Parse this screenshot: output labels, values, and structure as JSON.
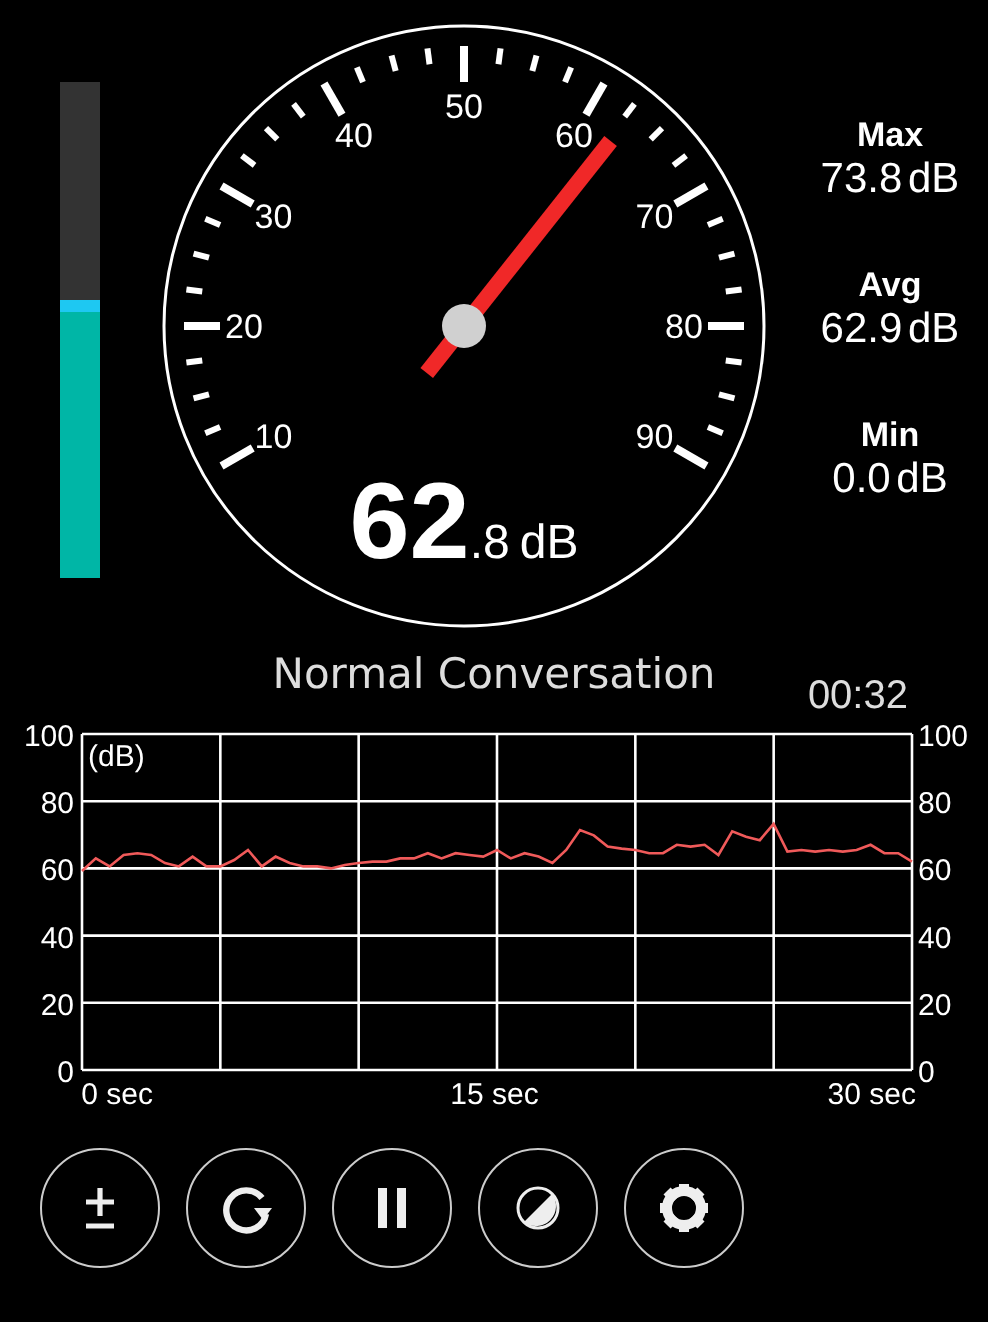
{
  "level_bar": {
    "level": 0.56
  },
  "gauge": {
    "labels": [
      "10",
      "20",
      "30",
      "40",
      "50",
      "60",
      "70",
      "80",
      "90"
    ],
    "reading": {
      "integer": "62",
      "decimal": ".8",
      "unit": "dB"
    }
  },
  "stats": [
    {
      "label": "Max",
      "value": "73.8 dB"
    },
    {
      "label": "Avg",
      "value": "62.9 dB"
    },
    {
      "label": "Min",
      "value": "0.0 dB"
    }
  ],
  "history": {
    "title": "Normal Conversation",
    "elapsed": "00:32",
    "left_yticks": [
      "100",
      "80",
      "60",
      "40",
      "20",
      "0"
    ],
    "right_yticks": [
      "100",
      "80",
      "60",
      "40",
      "20",
      "0"
    ],
    "chart_data": {
      "type": "line",
      "ylabel": "(dB)",
      "grid": true,
      "xlim": [
        -1.4,
        31.6
      ],
      "ylim": [
        0,
        100
      ],
      "xticks": [
        {
          "value": 0,
          "label": "0 sec"
        },
        {
          "value": 15,
          "label": "15 sec"
        },
        {
          "value": 30,
          "label": "30 sec"
        }
      ],
      "yticks": [
        0,
        20,
        40,
        60,
        80,
        100
      ],
      "x": [
        -1.4,
        -0.85,
        -0.3,
        0.25,
        0.8,
        1.35,
        1.9,
        2.45,
        3,
        3.55,
        4.1,
        4.65,
        5.2,
        5.75,
        6.3,
        6.85,
        7.4,
        7.95,
        8.5,
        9.05,
        9.6,
        10.15,
        10.7,
        11.25,
        11.8,
        12.35,
        12.9,
        13.45,
        14,
        14.55,
        15.1,
        15.65,
        16.2,
        16.75,
        17.3,
        17.85,
        18.4,
        18.95,
        19.5,
        20.05,
        20.6,
        21.15,
        21.7,
        22.25,
        22.8,
        23.35,
        23.9,
        24.45,
        25,
        25.55,
        26.1,
        26.65,
        27.2,
        27.75,
        28.3,
        28.85,
        29.4,
        29.95,
        30.5,
        31.05,
        31.6
      ],
      "series": [
        {
          "color": "#f05a5a",
          "values": [
            59.2,
            63,
            60.6,
            64,
            64.5,
            64,
            61.6,
            60.6,
            63.5,
            60.6,
            60.6,
            62.5,
            65.5,
            60.6,
            63.5,
            61.6,
            60.6,
            60.6,
            60,
            61,
            61.6,
            62,
            62,
            63,
            63,
            64.5,
            63,
            64.5,
            64,
            63.5,
            65.5,
            63,
            64.5,
            63.5,
            61.6,
            65.5,
            71.4,
            69.8,
            66.5,
            65.9,
            65.5,
            64.5,
            64.5,
            67,
            66.5,
            67,
            64,
            71,
            69.4,
            68.4,
            73.3,
            65,
            65.5,
            65,
            65.5,
            65,
            65.5,
            67,
            64.5,
            64.5,
            62
          ]
        }
      ]
    }
  },
  "buttons": [
    {
      "kind": "calibrate"
    },
    {
      "kind": "reset"
    },
    {
      "kind": "pause"
    },
    {
      "kind": "theme"
    },
    {
      "kind": "settings"
    }
  ]
}
